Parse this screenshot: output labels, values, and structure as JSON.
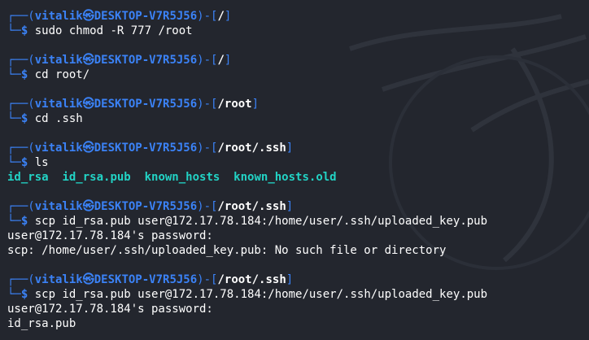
{
  "prompt": {
    "user": "vitalik",
    "at": "㉿",
    "host": "DESKTOP-V7R5J56",
    "top_left": "┌──(",
    "mid": ")-[",
    "end": "]",
    "bottom_left": "└─",
    "dollar": "$"
  },
  "blocks": [
    {
      "cwd": "/",
      "command": "sudo chmod -R 777 /root",
      "output": []
    },
    {
      "cwd": "/",
      "command": "cd root/",
      "output": []
    },
    {
      "cwd": "/root",
      "command": "cd .ssh",
      "output": []
    },
    {
      "cwd": "/root/.ssh",
      "command": "ls",
      "ls_items": [
        "id_rsa",
        "id_rsa.pub",
        "known_hosts",
        "known_hosts.old"
      ]
    },
    {
      "cwd": "/root/.ssh",
      "command": "scp id_rsa.pub user@172.17.78.184:/home/user/.ssh/uploaded_key.pub",
      "output": [
        "user@172.17.78.184's password:",
        "scp: /home/user/.ssh/uploaded_key.pub: No such file or directory"
      ]
    },
    {
      "cwd": "/root/.ssh",
      "command": "scp id_rsa.pub user@172.17.78.184:/home/user/.ssh/uploaded_key.pub",
      "output": [
        "user@172.17.78.184's password:",
        "id_rsa.pub"
      ]
    }
  ],
  "colors": {
    "background": "#23262e",
    "prompt_blue": "#3b82f6",
    "ls_cyan": "#22d3c5",
    "text": "#ffffff"
  },
  "icons": {
    "watermark": "kali-dragon-watermark"
  }
}
